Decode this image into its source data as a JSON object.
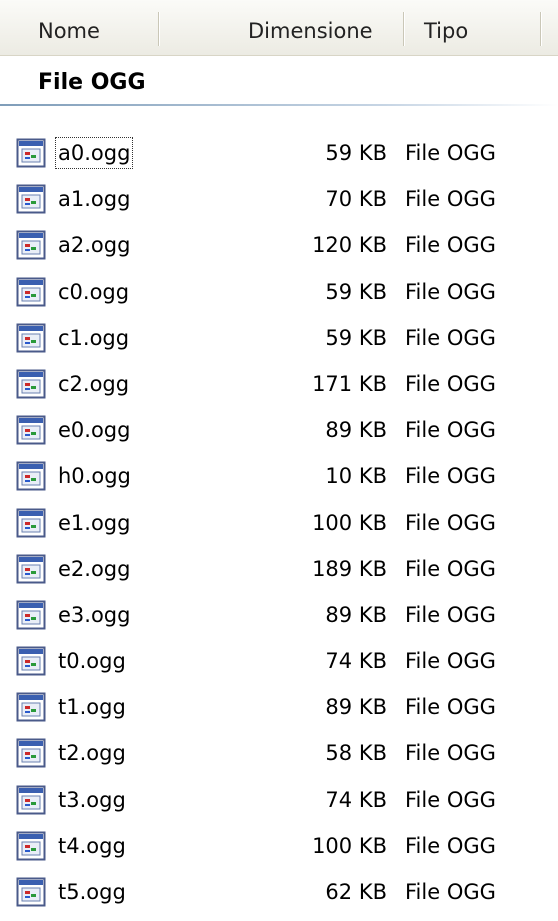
{
  "header": {
    "col_name": "Nome",
    "col_size": "Dimensione",
    "col_type": "Tipo"
  },
  "group": {
    "title": "File OGG"
  },
  "files": [
    {
      "name": "a0.ogg",
      "size": "59 KB",
      "type": "File OGG"
    },
    {
      "name": "a1.ogg",
      "size": "70 KB",
      "type": "File OGG"
    },
    {
      "name": "a2.ogg",
      "size": "120 KB",
      "type": "File OGG"
    },
    {
      "name": "c0.ogg",
      "size": "59 KB",
      "type": "File OGG"
    },
    {
      "name": "c1.ogg",
      "size": "59 KB",
      "type": "File OGG"
    },
    {
      "name": "c2.ogg",
      "size": "171 KB",
      "type": "File OGG"
    },
    {
      "name": "e0.ogg",
      "size": "89 KB",
      "type": "File OGG"
    },
    {
      "name": "h0.ogg",
      "size": "10 KB",
      "type": "File OGG"
    },
    {
      "name": "e1.ogg",
      "size": "100 KB",
      "type": "File OGG"
    },
    {
      "name": "e2.ogg",
      "size": "189 KB",
      "type": "File OGG"
    },
    {
      "name": "e3.ogg",
      "size": "89 KB",
      "type": "File OGG"
    },
    {
      "name": "t0.ogg",
      "size": "74 KB",
      "type": "File OGG"
    },
    {
      "name": "t1.ogg",
      "size": "89 KB",
      "type": "File OGG"
    },
    {
      "name": "t2.ogg",
      "size": "58 KB",
      "type": "File OGG"
    },
    {
      "name": "t3.ogg",
      "size": "74 KB",
      "type": "File OGG"
    },
    {
      "name": "t4.ogg",
      "size": "100 KB",
      "type": "File OGG"
    },
    {
      "name": "t5.ogg",
      "size": "62 KB",
      "type": "File OGG"
    }
  ],
  "icon": "media-file-icon",
  "colors": {
    "accent": "#7f9db9",
    "header_bg": "#ecebe3"
  }
}
